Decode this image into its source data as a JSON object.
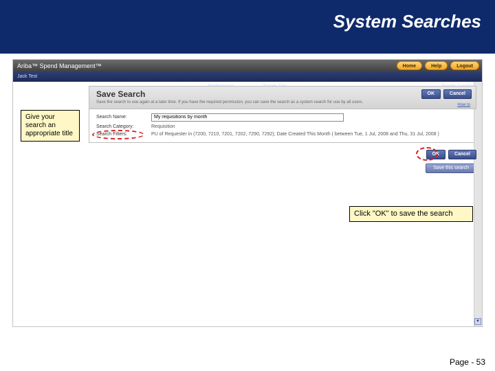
{
  "slide": {
    "title": "System Searches",
    "page_label": "Page - 53"
  },
  "callouts": {
    "left": "Give your search an appropriate title",
    "right": "Click \"OK\" to save the search"
  },
  "app": {
    "brand": "Ariba™ Spend Management™",
    "brand_buttons": {
      "home": "Home",
      "help": "Help",
      "logout": "Logout"
    },
    "nav": {
      "user": "Jack Test",
      "preferences": "Preferences",
      "toggle_tips": "Toggle Tips",
      "toggle_currency": "Toggle Currency"
    },
    "panel": {
      "title": "Save Search",
      "desc": "Save the search to use again at a later time. If you have the required permission, you can save the search as a system search for use by all users.",
      "howto": "How to",
      "ok": "OK",
      "cancel": "Cancel"
    },
    "form": {
      "name_label": "Search Name:",
      "name_value": "My requisitions by month",
      "category_label": "Search Category:",
      "category_value": "Requisition",
      "filters_label": "Search Filters:",
      "filters_value": "PU of Requester in (7200, 7210, 7201, 7202, 7290, 7292); Date Created   This Month ( between Tue, 1 Jul, 2008 and Thu, 31 Jul, 2008 )"
    },
    "secondary": {
      "ok": "OK",
      "cancel": "Cancel",
      "save_query": "Save this search"
    }
  }
}
